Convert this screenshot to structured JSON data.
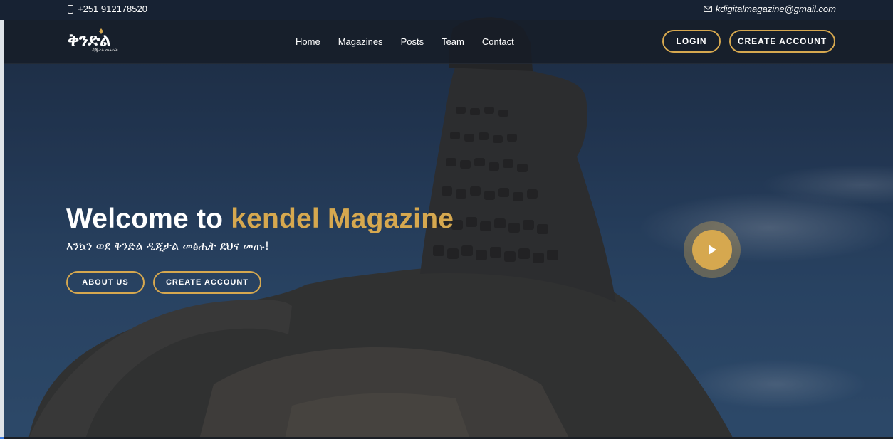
{
  "topbar": {
    "phone": "+251 912178520",
    "email": "kdigitalmagazine@gmail.com"
  },
  "navbar": {
    "logo_text": "ቅንድል",
    "logo_subtext": "ዲጂታል መፅሔት",
    "links": [
      "Home",
      "Magazines",
      "Posts",
      "Team",
      "Contact"
    ],
    "login_label": "LOGIN",
    "create_account_label": "CREATE ACCOUNT"
  },
  "hero": {
    "title_prefix": "Welcome to",
    "title_accent": "kendel Magazine",
    "subtitle": "እንኳን ወደ ቅንድል ዲጂታል መፅሔት ደህና መጡ!",
    "about_label": "ABOUT US",
    "create_account_label": "CREATE ACCOUNT"
  },
  "colors": {
    "accent": "#d6a84f",
    "nav_bg": "#161c26",
    "sky": "#34557c"
  },
  "icons": {
    "phone": "phone-icon",
    "email": "mail-icon",
    "play": "play-icon"
  }
}
